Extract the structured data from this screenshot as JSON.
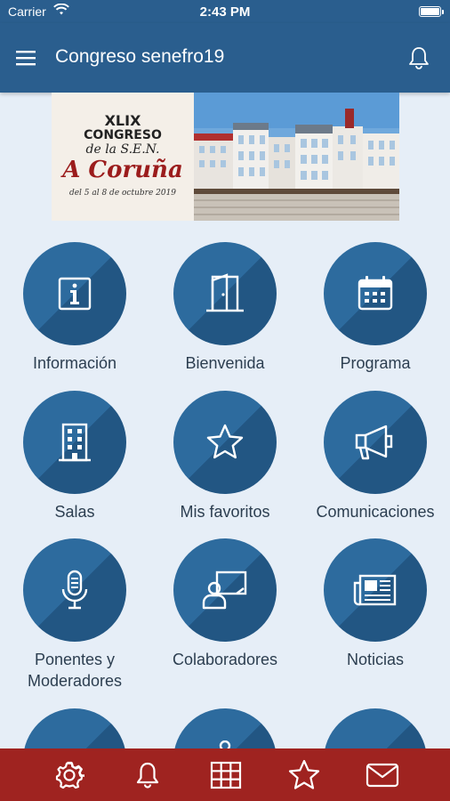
{
  "status": {
    "carrier": "Carrier",
    "time": "2:43 PM"
  },
  "navbar": {
    "title": "Congreso senefro19",
    "menu_icon": "hamburger-menu-icon",
    "notifications_icon": "bell-icon"
  },
  "banner": {
    "line1": "XLIX",
    "line2": "CONGRESO",
    "line3": "de la S.E.N.",
    "city": "A Coruña",
    "dates": "del 5 al 8 de octubre 2019"
  },
  "tiles": [
    {
      "label": "Información",
      "icon": "info-icon"
    },
    {
      "label": "Bienvenida",
      "icon": "door-icon"
    },
    {
      "label": "Programa",
      "icon": "calendar-icon"
    },
    {
      "label": "Salas",
      "icon": "building-icon"
    },
    {
      "label": "Mis favoritos",
      "icon": "star-icon"
    },
    {
      "label": "Comunicaciones",
      "icon": "megaphone-icon"
    },
    {
      "label": "Ponentes y Moderadores",
      "icon": "microphone-icon"
    },
    {
      "label": "Colaboradores",
      "icon": "presenter-icon"
    },
    {
      "label": "Noticias",
      "icon": "newspaper-icon"
    }
  ],
  "tabbar": [
    "settings-icon",
    "bell-icon",
    "grid-icon",
    "star-icon",
    "mail-icon"
  ],
  "colors": {
    "primary": "#2a5e8e",
    "circle_light": "#2d6b9e",
    "circle_dark": "#225683",
    "tabbar": "#9f2320",
    "background": "#e6eef7"
  }
}
